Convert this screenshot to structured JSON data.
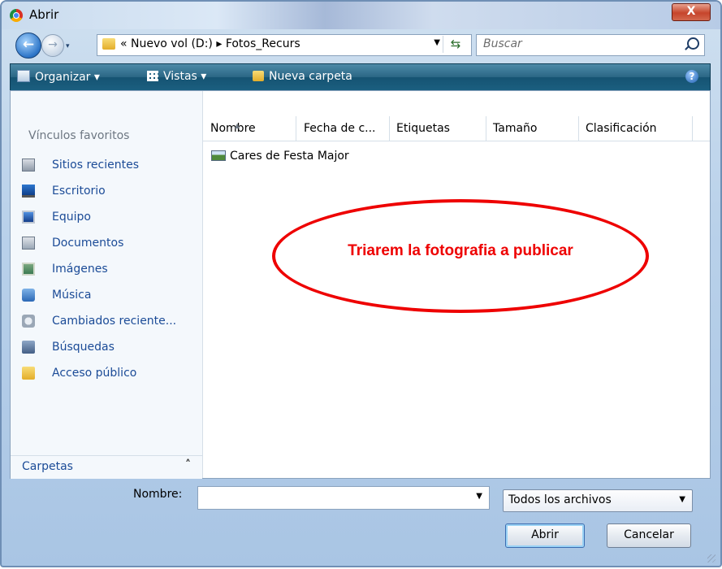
{
  "window": {
    "title": "Abrir",
    "close_label": "X"
  },
  "nav": {
    "back_glyph": "←",
    "forward_glyph": "→",
    "history_dd": "▾",
    "address_path": "«  Nuevo vol (D:)  ▸  Fotos_Recurs",
    "address_dd": "▼",
    "refresh_glyph": "⇆",
    "search_placeholder": "Buscar"
  },
  "toolbar": {
    "organize": "Organizar ▾",
    "views": "Vistas ▾",
    "new_folder": "Nueva carpeta",
    "help": "?"
  },
  "sidebar": {
    "title": "Vínculos favoritos",
    "items": [
      {
        "label": "Sitios recientes",
        "icon": "recent-places-icon"
      },
      {
        "label": "Escritorio",
        "icon": "desktop-icon"
      },
      {
        "label": "Equipo",
        "icon": "computer-icon"
      },
      {
        "label": "Documentos",
        "icon": "documents-icon"
      },
      {
        "label": "Imágenes",
        "icon": "pictures-icon"
      },
      {
        "label": "Música",
        "icon": "music-icon"
      },
      {
        "label": "Cambiados reciente...",
        "icon": "recently-changed-icon"
      },
      {
        "label": "Búsquedas",
        "icon": "searches-icon"
      },
      {
        "label": "Acceso público",
        "icon": "public-icon"
      }
    ],
    "folders_label": "Carpetas",
    "folders_chevron": "˄"
  },
  "columns": [
    "Nombre",
    "Fecha de c...",
    "Etiquetas",
    "Tamaño",
    "Clasificación"
  ],
  "files": [
    {
      "name": "Cares de Festa Major",
      "icon": "image-folder-icon"
    }
  ],
  "annotation": {
    "text": "Triarem la fotografia a publicar",
    "color": "#ee0000"
  },
  "footer": {
    "name_label": "Nombre:",
    "name_value": "",
    "name_dd": "▼",
    "filter_value": "Todos los archivos",
    "filter_dd": "▼",
    "open_label": "Abrir",
    "cancel_label": "Cancelar"
  },
  "colors": {
    "toolbar": "#1b5f80",
    "link": "#1b4b97",
    "close": "#c6452c"
  }
}
